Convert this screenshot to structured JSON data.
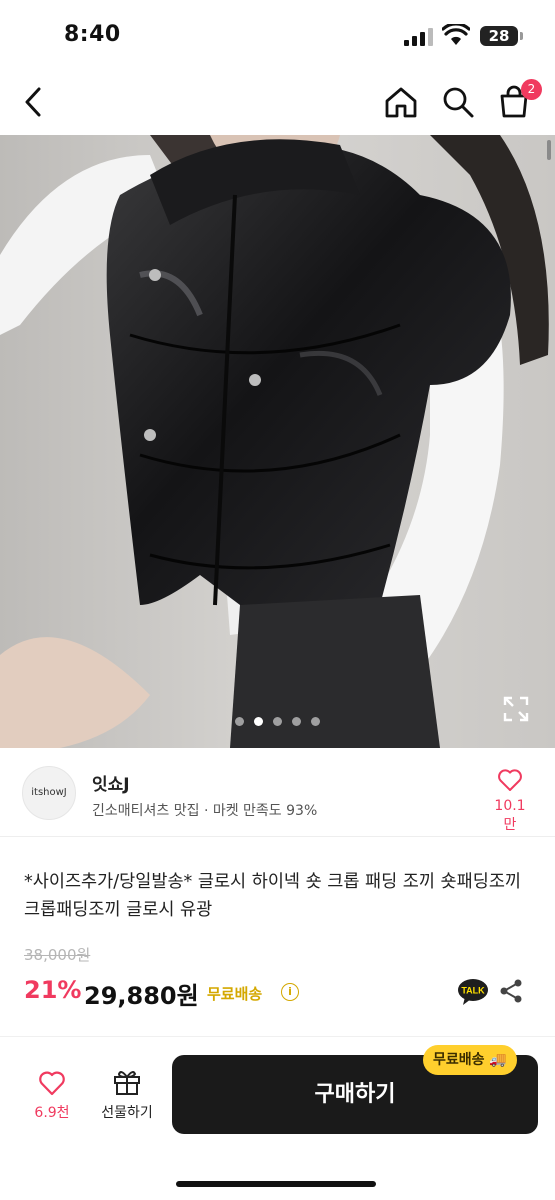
{
  "status": {
    "time": "8:40",
    "battery": "28"
  },
  "header": {
    "cart_count": "2"
  },
  "gallery": {
    "page_index": 2,
    "page_count": 5
  },
  "shop": {
    "logo_text": "itshowJ",
    "name": "잇쇼J",
    "subtitle": "긴소매티셔츠 맛집 · 마켓 만족도 93%",
    "likes": "10.1만"
  },
  "product": {
    "title": "*사이즈추가/당일발송* 글로시 하이넥 숏 크롭 패딩 조끼 숏패딩조끼 크롭패딩조끼 글로시 유광",
    "original_price": "38,000원",
    "discount": "21%",
    "price": "29,880원",
    "shipping": "무료배송",
    "talk_label": "TALK"
  },
  "bottom_bar": {
    "wish_count": "6.9천",
    "gift_label": "선물하기",
    "buy_label": "구매하기",
    "free_shipping_tag": "무료배송 🚚"
  },
  "colors": {
    "accent": "#f03a5f",
    "buy_button": "#1a1a1a",
    "shipping": "#d4a800",
    "tag": "#ffcf2d"
  }
}
